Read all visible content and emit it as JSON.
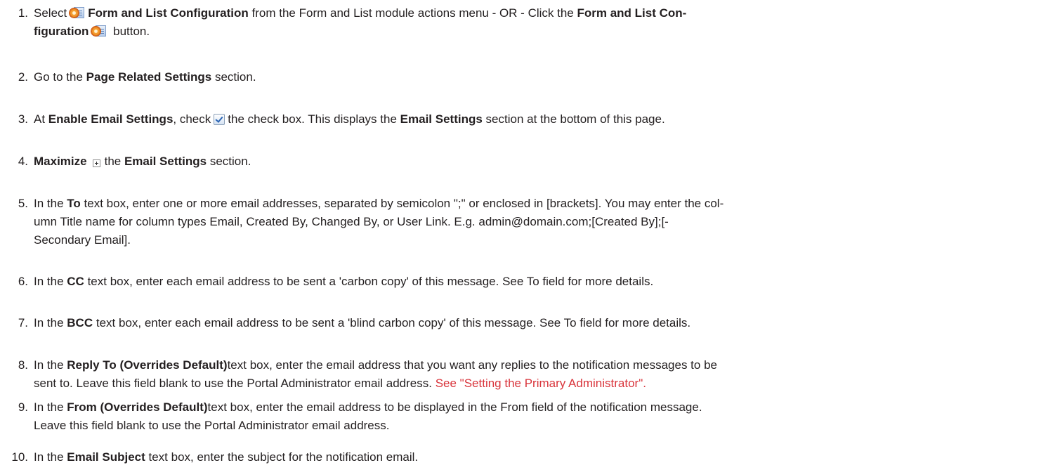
{
  "steps": [
    {
      "num": "1.",
      "a": "Select",
      "b": "Form and List Configuration",
      "c": "from the Form and List module actions menu - OR - Click the",
      "d": "Form and List Con-",
      "e": "figuration",
      "f": "button.",
      "icon": "form-and-list-configuration-icon"
    },
    {
      "num": "2.",
      "a": "Go to the",
      "b": "Page Related Settings",
      "c": "section."
    },
    {
      "num": "3.",
      "a": "At",
      "b": "Enable Email Settings",
      "c": ", check",
      "d": "the check box. This displays the",
      "e": "Email Settings",
      "f": "section at the bottom of this page.",
      "icon": "checked-checkbox-icon"
    },
    {
      "num": "4.",
      "b": "Maximize",
      "c": "the",
      "d": "Email Settings",
      "e": "section.",
      "icon": "maximize-plus-icon"
    },
    {
      "num": "5.",
      "a": "In the",
      "b": "To",
      "c": "text box, enter one or more email addresses, separated by semicolon \";\" or enclosed in [brackets]. You may enter the col-",
      "d": "umn Title name for column types Email, Created By, Changed By, or User Link. E.g. admin@domain.com;[Created By];[-",
      "e": "Secondary Email]."
    },
    {
      "num": "6.",
      "a": "In the",
      "b": "CC",
      "c": "text box, enter each email address to be sent a 'carbon copy' of this message. See To field for more details."
    },
    {
      "num": "7.",
      "a": "In the",
      "b": "BCC",
      "c": "text box, enter each email address to be sent a 'blind carbon copy' of this message. See To field for more details."
    },
    {
      "num": "8.",
      "a": "In the",
      "b": "Reply To (Overrides Default)",
      "c": "text box, enter the email address that you want any replies to the notification messages to be",
      "d": "sent to. Leave this field blank to use the Portal Administrator email address.",
      "link": "See \"Setting the Primary Administrator\"."
    },
    {
      "num": "9.",
      "a": "In the",
      "b": "From (Overrides Default)",
      "c": "text box, enter the email address to be displayed in the From field of the notification message.",
      "d": "Leave this field blank to use the Portal Administrator email address."
    },
    {
      "num": "10.",
      "a": "In the",
      "b": "Email Subject",
      "c": "text box, enter the subject for the notification email."
    }
  ]
}
